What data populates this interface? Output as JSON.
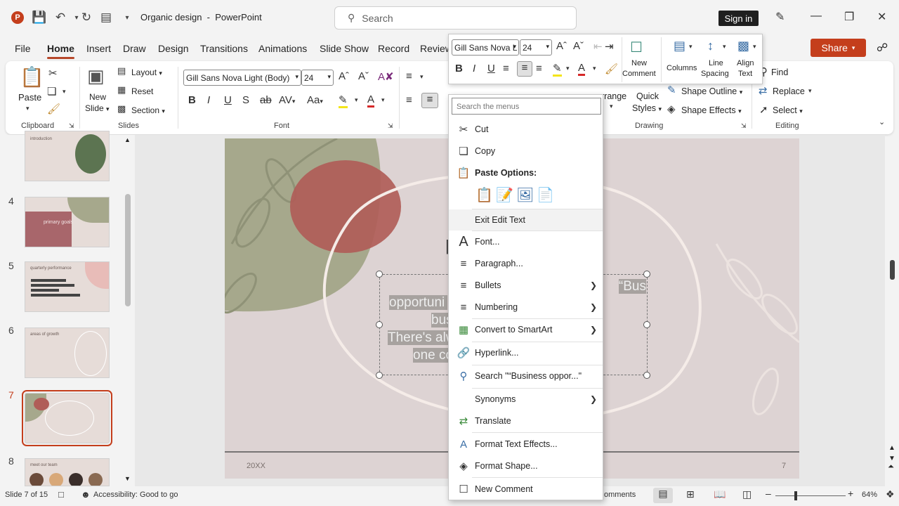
{
  "window": {
    "doc_name": "Organic design",
    "app_name": "PowerPoint",
    "search_placeholder": "Search",
    "signin": "Sign in"
  },
  "tabs": [
    "File",
    "Home",
    "Insert",
    "Draw",
    "Design",
    "Transitions",
    "Animations",
    "Slide Show",
    "Record",
    "Review"
  ],
  "share_label": "Share",
  "ribbon": {
    "clipboard": {
      "paste": "Paste",
      "label": "Clipboard"
    },
    "slides": {
      "new_slide": "New",
      "new_slide2": "Slide",
      "layout": "Layout",
      "reset": "Reset",
      "section": "Section",
      "label": "Slides"
    },
    "font": {
      "font_name": "Gill Sans Nova Light (Body)",
      "font_size": "24",
      "label": "Font"
    },
    "drawing": {
      "arrange": "rrange",
      "quick_styles": "Quick",
      "quick_styles2": "Styles",
      "shape_outline": "Shape Outline",
      "shape_effects": "Shape Effects",
      "label": "Drawing"
    },
    "editing": {
      "find": "Find",
      "replace": "Replace",
      "select": "Select",
      "label": "Editing"
    }
  },
  "mini_toolbar": {
    "font_name": "Gill Sans Nova L",
    "font_size": "24",
    "new_comment": "New",
    "new_comment2": "Comment",
    "columns": "Columns",
    "line_spacing": "Line",
    "line_spacing2": "Spacing",
    "align_text": "Align",
    "align_text2": "Text"
  },
  "thumbnails": [
    {
      "num": "",
      "title": "introduction"
    },
    {
      "num": "4",
      "title": "primary goals"
    },
    {
      "num": "5",
      "title": "quarterly performance"
    },
    {
      "num": "6",
      "title": "areas of growth"
    },
    {
      "num": "7",
      "title": ""
    },
    {
      "num": "8",
      "title": "meet our team"
    }
  ],
  "slide": {
    "text_lines": [
      "“Bus",
      "opportuni",
      "bus",
      "There's alw",
      "one co"
    ],
    "footer_left": "20XX",
    "footer_right": "7"
  },
  "context_menu": {
    "search_placeholder": "Search the menus",
    "cut": "Cut",
    "copy": "Copy",
    "paste_options": "Paste Options:",
    "exit_edit": "Exit Edit Text",
    "font": "Font...",
    "paragraph": "Paragraph...",
    "bullets": "Bullets",
    "numbering": "Numbering",
    "smartart": "Convert to SmartArt",
    "hyperlink": "Hyperlink...",
    "search": "Search \"“Business oppor...\"",
    "synonyms": "Synonyms",
    "translate": "Translate",
    "text_effects": "Format Text Effects...",
    "format_shape": "Format Shape...",
    "new_comment": "New Comment"
  },
  "status": {
    "slide_of": "Slide 7 of 15",
    "accessibility": "Accessibility: Good to go",
    "comments": "omments",
    "zoom": "64%"
  },
  "colors": {
    "accent": "#c43e1c",
    "tab_underline": "#b7472a"
  }
}
